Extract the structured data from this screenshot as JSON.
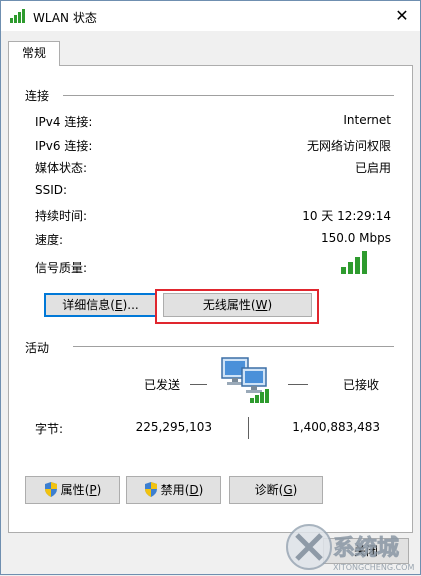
{
  "window": {
    "title": "WLAN 状态",
    "close_glyph": "✕"
  },
  "tab": {
    "label": "常规"
  },
  "connection": {
    "heading": "连接",
    "rows": [
      {
        "label": "IPv4 连接:",
        "value": "Internet"
      },
      {
        "label": "IPv6 连接:",
        "value": "无网络访问权限"
      },
      {
        "label": "媒体状态:",
        "value": "已启用"
      },
      {
        "label": "SSID:",
        "value": ""
      },
      {
        "label": "持续时间:",
        "value": "10 天 12:29:14"
      },
      {
        "label": "速度:",
        "value": "150.0 Mbps"
      },
      {
        "label": "信号质量:",
        "value": ""
      }
    ],
    "signal_icon": "signal-bars-icon",
    "details_button": {
      "text": "详细信息",
      "hotkey": "E",
      "suffix": "..."
    },
    "wireless_button": {
      "text": "无线属性",
      "hotkey": "W"
    }
  },
  "activity": {
    "heading": "活动",
    "sent_label": "已发送",
    "received_label": "已接收",
    "bytes_label": "字节:",
    "bytes_sent": "225,295,103",
    "bytes_received": "1,400,883,483"
  },
  "buttons": {
    "properties": {
      "text": "属性",
      "hotkey": "P"
    },
    "disable": {
      "text": "禁用",
      "hotkey": "D"
    },
    "diagnose": {
      "text": "诊断",
      "hotkey": "G"
    },
    "close": {
      "text": "关闭"
    }
  },
  "watermark": {
    "text": "系统城",
    "sub": "XITONGCHENG.COM"
  },
  "colors": {
    "highlight_box": "#e0262e",
    "default_button_border": "#0078d7",
    "signal_green": "#2e9b2e"
  }
}
